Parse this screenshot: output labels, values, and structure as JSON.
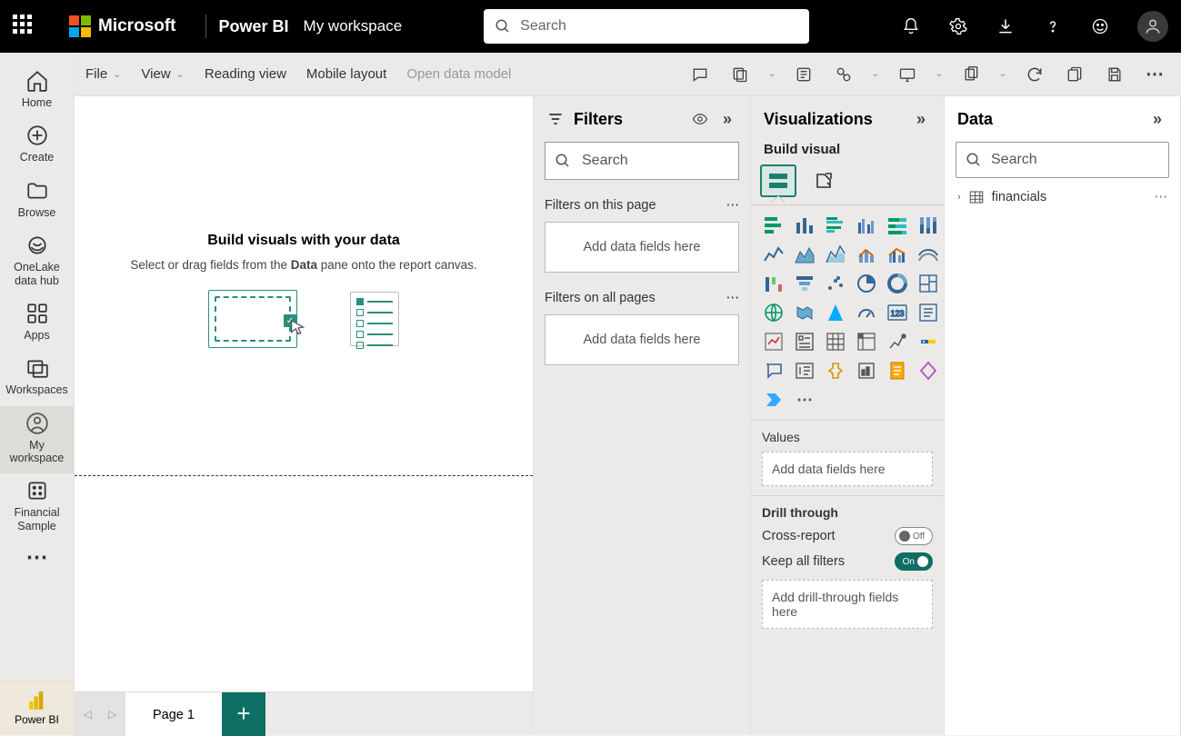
{
  "top": {
    "ms": "Microsoft",
    "product": "Power BI",
    "workspace": "My workspace",
    "search": "Search"
  },
  "nav": {
    "home": "Home",
    "create": "Create",
    "browse": "Browse",
    "onelake1": "OneLake",
    "onelake2": "data hub",
    "apps": "Apps",
    "workspaces": "Workspaces",
    "my1": "My",
    "my2": "workspace",
    "fin1": "Financial",
    "fin2": "Sample",
    "pbi": "Power BI"
  },
  "ribbon": {
    "file": "File",
    "view": "View",
    "reading": "Reading view",
    "mobile": "Mobile layout",
    "open": "Open data model"
  },
  "canvas": {
    "title": "Build visuals with your data",
    "sub_before": "Select or drag fields from the ",
    "sub_bold": "Data",
    "sub_after": " pane onto the report canvas.",
    "page": "Page 1"
  },
  "filters": {
    "title": "Filters",
    "search": "Search",
    "on_page": "Filters on this page",
    "on_all": "Filters on all pages",
    "drop": "Add data fields here"
  },
  "viz": {
    "title": "Visualizations",
    "build": "Build visual",
    "values": "Values",
    "values_drop": "Add data fields here",
    "drill": "Drill through",
    "cross": "Cross-report",
    "cross_state": "Off",
    "keep": "Keep all filters",
    "keep_state": "On",
    "drill_drop": "Add drill-through fields here"
  },
  "data": {
    "title": "Data",
    "search": "Search",
    "table": "financials"
  }
}
